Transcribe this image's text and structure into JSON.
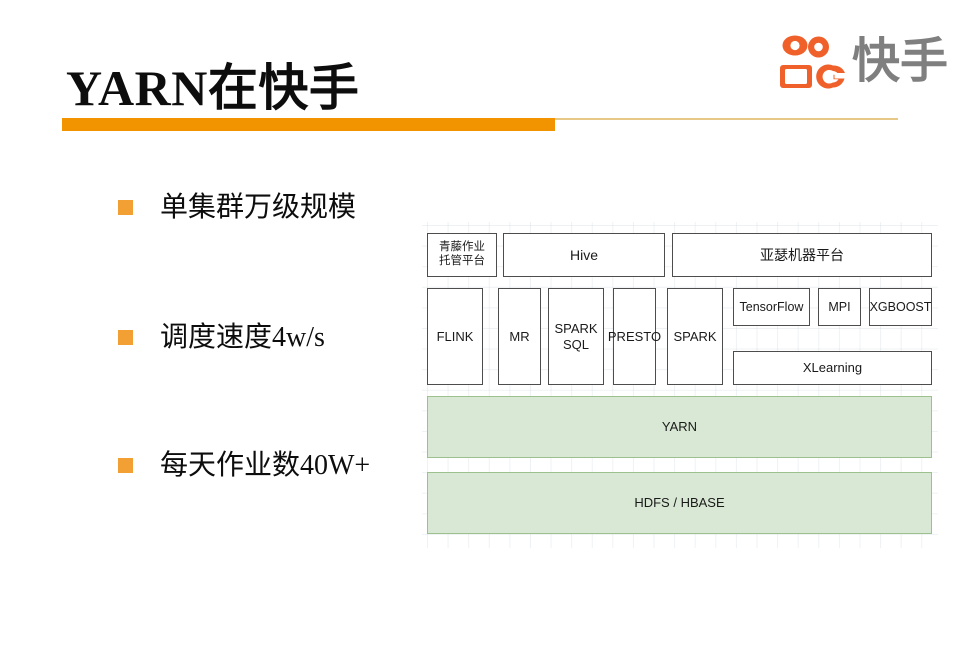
{
  "slide": {
    "title": "YARN在快手",
    "background_color": "#ffffff"
  },
  "logo": {
    "wordmark": "快手",
    "mark_color": "#f0602a",
    "word_color": "#7f7f7f"
  },
  "divider": {
    "accent_color": "#f29400",
    "line_color": "#e8c886"
  },
  "bullets": {
    "marker_color": "#f2a033",
    "items": [
      {
        "text": "单集群万级规模"
      },
      {
        "text": "调度速度4w/s"
      },
      {
        "text": "每天作业数40W+"
      }
    ]
  },
  "diagram": {
    "white_fill": "#ffffff",
    "white_border": "#4d4d4d",
    "green_fill": "#d9e8d4",
    "green_border": "#9cc08e",
    "row_platform": [
      {
        "label": "青藤作业\n托管平台",
        "line1": "青藤作业",
        "line2": "托管平台"
      },
      {
        "label": "Hive"
      },
      {
        "label": "亚瑟机器平台"
      }
    ],
    "row_engines": [
      {
        "label": "FLINK"
      },
      {
        "label": "MR"
      },
      {
        "line1": "SPARK",
        "line2": "SQL"
      },
      {
        "label": "PRESTO"
      },
      {
        "label": "SPARK"
      }
    ],
    "row_ml": [
      {
        "label": "TensorFlow"
      },
      {
        "label": "MPI"
      },
      {
        "label": "XGBOOST"
      }
    ],
    "row_ml_wide": {
      "label": "XLearning"
    },
    "layer_yarn": {
      "label": "YARN"
    },
    "layer_storage": {
      "label": "HDFS / HBASE"
    }
  }
}
